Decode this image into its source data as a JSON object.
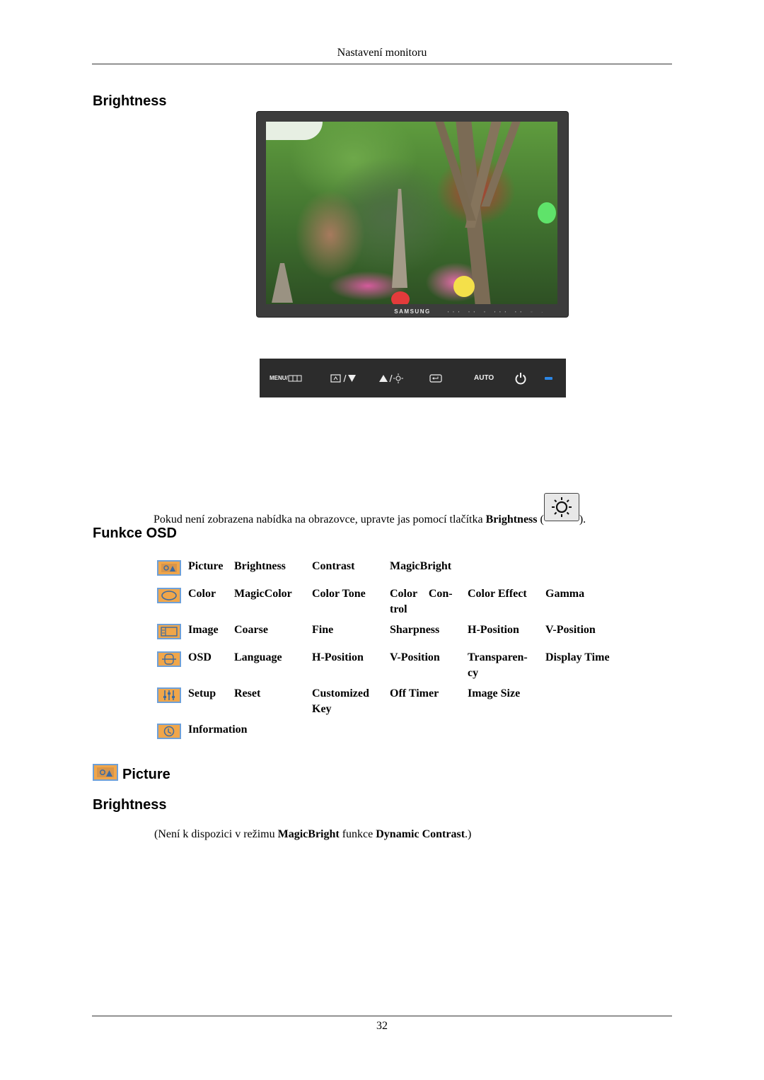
{
  "header": {
    "running_title": "Nastavení monitoru"
  },
  "sections": {
    "brightness_title": "Brightness",
    "osd_title": "Funkce OSD",
    "picture_title": "Picture",
    "picture_brightness_title": "Brightness"
  },
  "monitor": {
    "brand": "SAMSUNG",
    "bezel_buttons": "▪▪▪ ▪▪ ▪ ▪▪▪ ▪▪ ◌ -"
  },
  "control_strip": {
    "menu_label": "MENU/",
    "auto_label": "AUTO",
    "icons": [
      "menu-icon",
      "magicbright-down-icon",
      "up-brightness-icon",
      "source-enter-icon",
      "auto-button",
      "power-icon",
      "power-led"
    ],
    "led_color": "#2b86e6"
  },
  "instruction": {
    "text_before": "Pokud není zobrazena nabídka na obrazovce, upravte jas pomocí tlačítka ",
    "bold": "Brightness",
    "paren_open": " (",
    "paren_close": ")."
  },
  "osd_menu": {
    "rows": [
      {
        "icon": "picture-icon",
        "cells": [
          "Picture",
          "Brightness",
          "Contrast",
          "MagicBright",
          "",
          ""
        ]
      },
      {
        "icon": "color-icon",
        "cells": [
          "Color",
          "MagicColor",
          "Color Tone",
          "Color    Con-\ntrol",
          "Color Effect",
          "Gamma"
        ]
      },
      {
        "icon": "image-icon",
        "cells": [
          "Image",
          "Coarse",
          "Fine",
          "Sharpness",
          "H-Position",
          "V-Position"
        ]
      },
      {
        "icon": "osd-icon",
        "cells": [
          "OSD",
          "Language",
          "H-Position",
          "V-Position",
          "Transparen-\ncy",
          "Display Time"
        ]
      },
      {
        "icon": "setup-icon",
        "cells": [
          "Setup",
          "Reset",
          "Customized\nKey",
          "Off Timer",
          "Image Size",
          ""
        ]
      },
      {
        "icon": "information-icon",
        "cells": [
          "Information",
          "",
          "",
          "",
          "",
          ""
        ]
      }
    ]
  },
  "note": {
    "t1": "(Není k dispozici v režimu ",
    "b1": "MagicBright",
    "t2": " funkce ",
    "b2": "Dynamic Contrast",
    "t3": ".)"
  },
  "footer": {
    "page_number": "32"
  },
  "colors": {
    "osd_icon_fill": "#f0a64a",
    "osd_icon_border": "#6ea0d8",
    "monitor_bezel": "#3c3c3c",
    "strip_bg": "#2c2c2c"
  }
}
